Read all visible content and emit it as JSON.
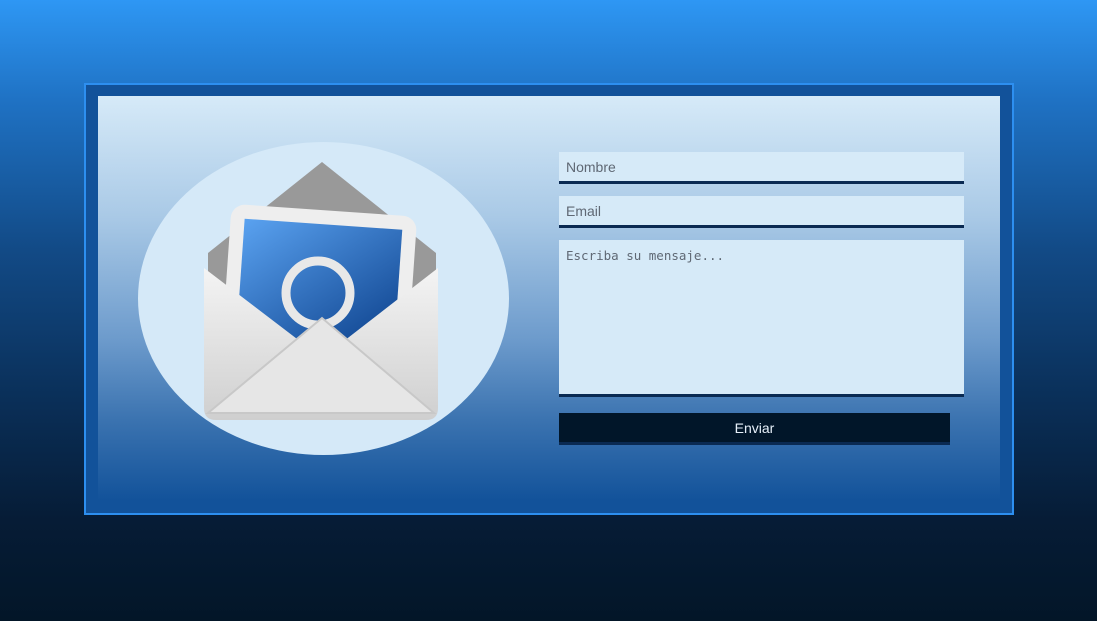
{
  "form": {
    "name_placeholder": "Nombre",
    "email_placeholder": "Email",
    "message_placeholder": "Escriba su mensaje...",
    "submit_label": "Enviar"
  },
  "colors": {
    "accent": "#2d8ff0",
    "frame": "#12529a",
    "field_bg": "#d6eaf8",
    "button_bg": "#011629"
  }
}
